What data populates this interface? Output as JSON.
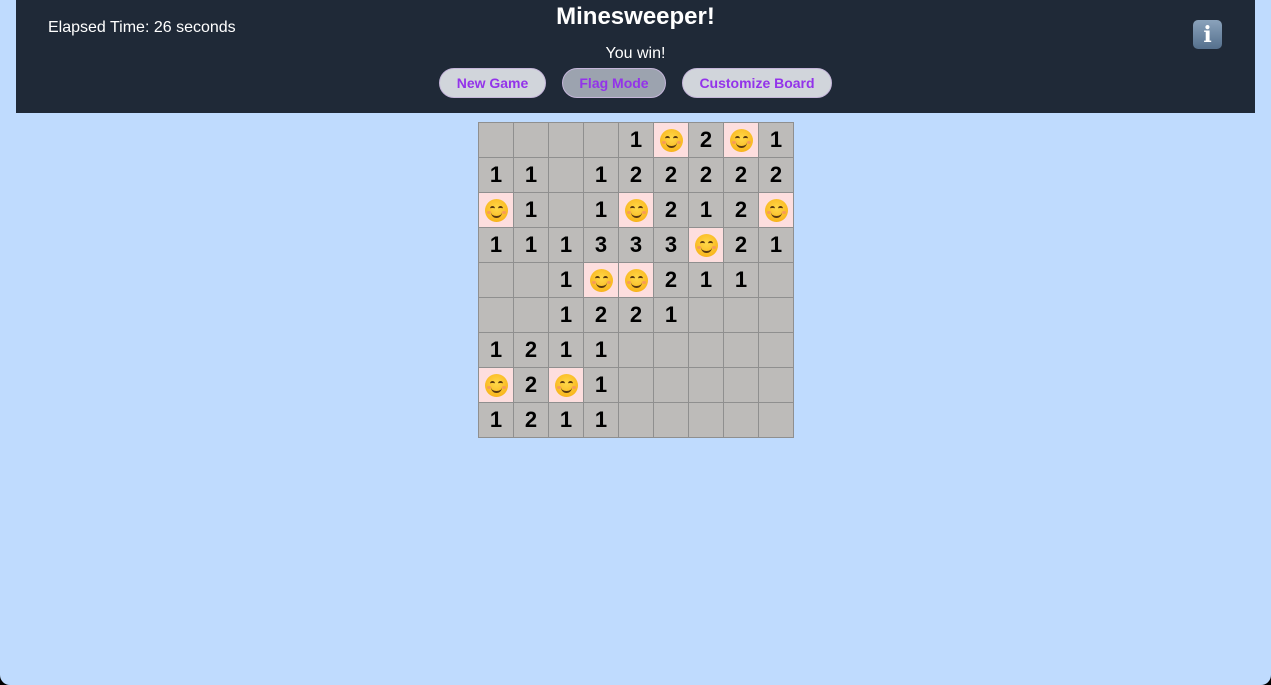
{
  "header": {
    "elapsed_label": "Elapsed Time: 26 seconds",
    "title": "Minesweeper!",
    "status": "You win!",
    "buttons": {
      "new_game": "New Game",
      "flag_mode": "Flag Mode",
      "customize": "Customize Board"
    },
    "flag_mode_active": true,
    "info_icon": "i"
  },
  "board": {
    "rows": 9,
    "cols": 9,
    "mine_icon": "smiling-face-emoji",
    "cells": [
      [
        "",
        "",
        "",
        "",
        "1",
        "M",
        "2",
        "M",
        "1"
      ],
      [
        "1",
        "1",
        "",
        "1",
        "2",
        "2",
        "2",
        "2",
        "2"
      ],
      [
        "M",
        "1",
        "",
        "1",
        "M",
        "2",
        "1",
        "2",
        "M"
      ],
      [
        "1",
        "1",
        "1",
        "3",
        "3",
        "3",
        "M",
        "2",
        "1"
      ],
      [
        "",
        "",
        "1",
        "M",
        "M",
        "2",
        "1",
        "1",
        ""
      ],
      [
        "",
        "",
        "1",
        "2",
        "2",
        "1",
        "",
        "",
        ""
      ],
      [
        "1",
        "2",
        "1",
        "1",
        "",
        "",
        "",
        "",
        ""
      ],
      [
        "M",
        "2",
        "M",
        "1",
        "",
        "",
        "",
        "",
        ""
      ],
      [
        "1",
        "2",
        "1",
        "1",
        "",
        "",
        "",
        "",
        ""
      ]
    ]
  },
  "colors": {
    "header_bg": "#1f2937",
    "page_bg": "#bfdbfe",
    "cell_bg": "#bdbbb9",
    "mine_cell_bg": "#fddede",
    "button_text": "#9333ea"
  }
}
